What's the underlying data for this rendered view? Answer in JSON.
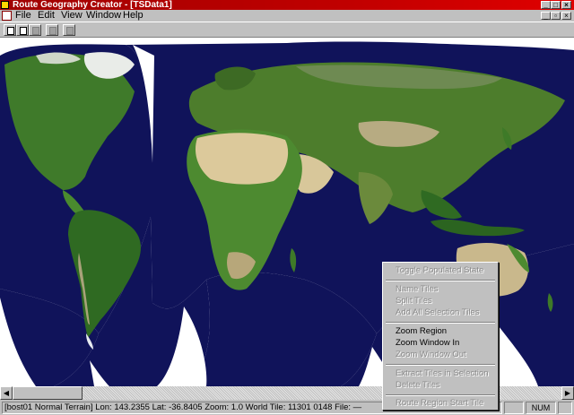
{
  "window": {
    "title": "Route Geography Creator - [TSData1]",
    "title_bar_color": "#c00000",
    "buttons": [
      "minimize-icon",
      "maximize-icon",
      "close-icon"
    ]
  },
  "menu": {
    "items": [
      "File",
      "Edit",
      "View",
      "Window",
      "Help"
    ]
  },
  "toolbar": {
    "buttons": [
      {
        "name": "new-icon",
        "enabled": true
      },
      {
        "name": "open-icon",
        "enabled": true
      },
      {
        "name": "save-icon",
        "enabled": false
      },
      {
        "name": "print-icon",
        "enabled": false
      },
      {
        "name": "grid-icon",
        "enabled": false
      }
    ]
  },
  "map": {
    "ocean_color": "#10135a",
    "land_color": "#3f7a2a",
    "desert_color": "#d9c79a",
    "ice_color": "#f2f2f2"
  },
  "context_menu": {
    "items": [
      {
        "label": "Toggle Populated State",
        "enabled": false
      },
      {
        "label": "Name Tiles",
        "enabled": false
      },
      {
        "label": "Split Tiles",
        "enabled": false
      },
      {
        "label": "Add All Selection Tiles",
        "enabled": false
      },
      {
        "label": "Zoom Region",
        "enabled": true
      },
      {
        "label": "Zoom Window In",
        "enabled": true
      },
      {
        "label": "Zoom Window Out",
        "enabled": false
      },
      {
        "label": "Extract Tiles in Selection",
        "enabled": false
      },
      {
        "label": "Delete Tiles",
        "enabled": false
      },
      {
        "label": "Route Region Start Tile",
        "enabled": false
      }
    ]
  },
  "status": {
    "main": "[bost01 Normal Terrain]  Lon: 143.2355  Lat: -36.8405  Zoom: 1.0   World Tile: 11301 0148  File: —",
    "num": "NUM"
  }
}
